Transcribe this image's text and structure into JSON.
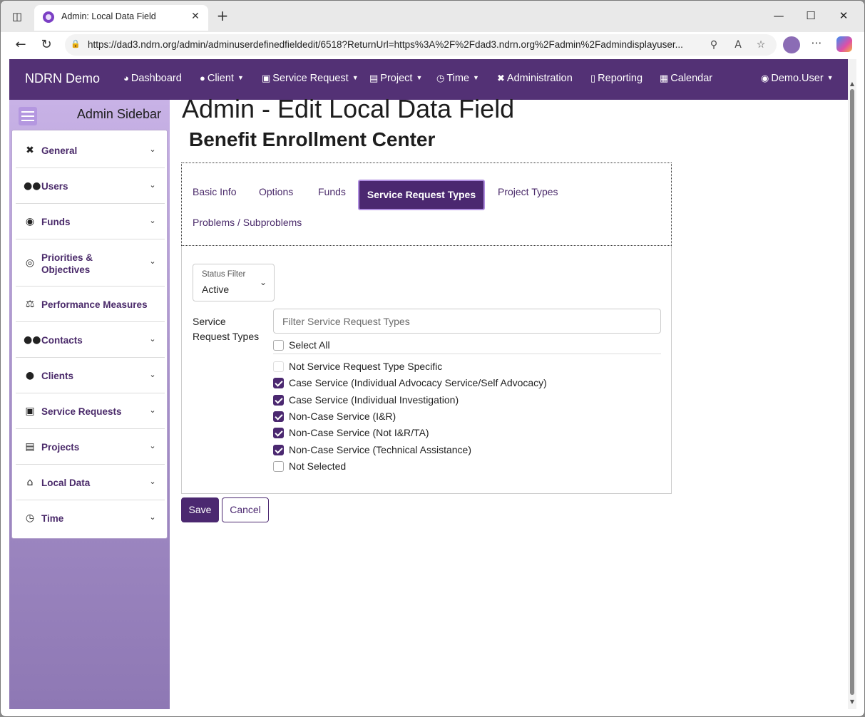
{
  "browser": {
    "tab_title": "Admin: Local Data Field",
    "url": "https://dad3.ndrn.org/admin/adminuserdefinedfieldedit/6518?ReturnUrl=https%3A%2F%2Fdad3.ndrn.org%2Fadmin%2Fadmindisplayuser..."
  },
  "navbar": {
    "brand": "NDRN Demo",
    "items": [
      {
        "label": "Dashboard",
        "icon": "dashboard-icon"
      },
      {
        "label": "Client",
        "icon": "user-icon"
      },
      {
        "label": "Service Request",
        "icon": "briefcase-icon"
      },
      {
        "label": "Project",
        "icon": "clipboard-icon"
      },
      {
        "label": "Time",
        "icon": "clock-icon"
      },
      {
        "label": "Administration",
        "icon": "tools-icon"
      },
      {
        "label": "Reporting",
        "icon": "file-icon"
      },
      {
        "label": "Calendar",
        "icon": "calendar-icon"
      }
    ],
    "user": "Demo.User"
  },
  "sidebar": {
    "title": "Admin Sidebar",
    "items": [
      {
        "label": "General",
        "icon": "tools-icon"
      },
      {
        "label": "Users",
        "icon": "users-icon"
      },
      {
        "label": "Funds",
        "icon": "money-bag-icon"
      },
      {
        "label": "Priorities & Objectives",
        "icon": "target-icon"
      },
      {
        "label": "Performance Measures",
        "icon": "scale-icon"
      },
      {
        "label": "Contacts",
        "icon": "users-icon"
      },
      {
        "label": "Clients",
        "icon": "user-icon"
      },
      {
        "label": "Service Requests",
        "icon": "briefcase-icon"
      },
      {
        "label": "Projects",
        "icon": "clipboard-icon"
      },
      {
        "label": "Local Data",
        "icon": "house-icon"
      },
      {
        "label": "Time",
        "icon": "clock-icon"
      }
    ]
  },
  "main": {
    "title": "Admin - Edit Local Data Field",
    "subtitle": "Benefit Enrollment Center",
    "tabs": [
      "Basic Info",
      "Options",
      "Funds",
      "Service Request Types",
      "Project Types",
      "Problems / Subproblems"
    ],
    "active_tab": "Service Request Types",
    "status_filter": {
      "label": "Status Filter",
      "value": "Active"
    },
    "field_label": "Service Request Types",
    "filter_placeholder": "Filter Service Request Types",
    "select_all": "Select All",
    "options": [
      {
        "label": "Not Service Request Type Specific",
        "checked": false,
        "disabled": true
      },
      {
        "label": "Case Service (Individual Advocacy Service/Self Advocacy)",
        "checked": true
      },
      {
        "label": "Case Service (Individual Investigation)",
        "checked": true
      },
      {
        "label": "Non-Case Service (I&R)",
        "checked": true
      },
      {
        "label": "Non-Case Service (Not I&R/TA)",
        "checked": true
      },
      {
        "label": "Non-Case Service (Technical Assistance)",
        "checked": true
      },
      {
        "label": "Not Selected",
        "checked": false
      }
    ],
    "save_label": "Save",
    "cancel_label": "Cancel"
  },
  "colors": {
    "navbar": "#533175",
    "accent": "#4b2870",
    "sidebar_top": "#c8b2e6",
    "sidebar_bottom": "#8e78b4"
  }
}
